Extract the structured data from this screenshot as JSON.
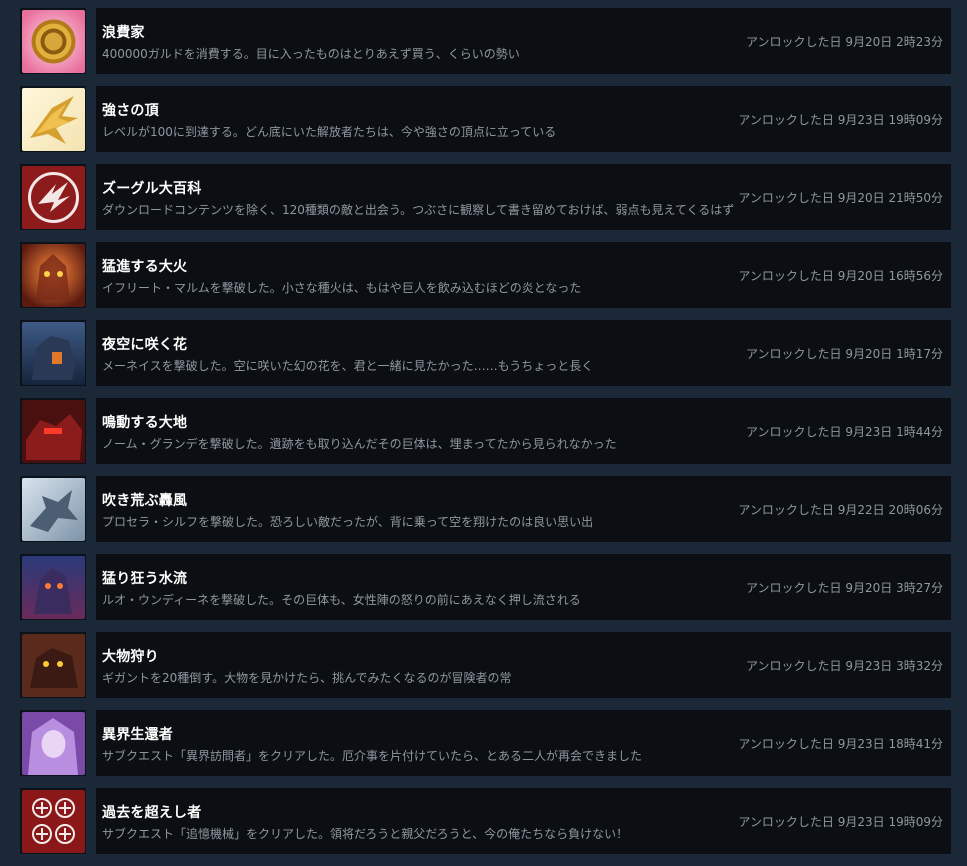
{
  "achievements": [
    {
      "title": "浪費家",
      "desc": "400000ガルドを消費する。目に入ったものはとりあえず買う、くらいの勢い",
      "date": "アンロックした日 9月20日 2時23分",
      "icon": "gold-coin-icon"
    },
    {
      "title": "強さの頂",
      "desc": "レベルが100に到達する。どん底にいた解放者たちは、今や強さの頂点に立っている",
      "date": "アンロックした日 9月23日 19時09分",
      "icon": "golden-bird-icon"
    },
    {
      "title": "ズーグル大百科",
      "desc": "ダウンロードコンテンツを除く、120種類の敵と出会う。つぶさに観察して書き留めておけば、弱点も見えてくるはず",
      "date": "アンロックした日 9月20日 21時50分",
      "icon": "red-claw-emblem-icon"
    },
    {
      "title": "猛進する大火",
      "desc": "イフリート・マルムを撃破した。小さな種火は、もはや巨人を飲み込むほどの炎となった",
      "date": "アンロックした日 9月20日 16時56分",
      "icon": "fire-giant-icon"
    },
    {
      "title": "夜空に咲く花",
      "desc": "メーネイスを撃破した。空に咲いた幻の花を、君と一緒に見たかった……もうちょっと長く",
      "date": "アンロックした日 9月20日 1時17分",
      "icon": "night-giant-icon"
    },
    {
      "title": "鳴動する大地",
      "desc": "ノーム・グランデを撃破した。遺跡をも取り込んだその巨体は、埋まってたから見られなかった",
      "date": "アンロックした日 9月23日 1時44分",
      "icon": "earth-giant-icon"
    },
    {
      "title": "吹き荒ぶ轟風",
      "desc": "プロセラ・シルフを撃破した。恐ろしい敵だったが、背に乗って空を翔けたのは良い思い出",
      "date": "アンロックした日 9月22日 20時06分",
      "icon": "wind-dragon-icon"
    },
    {
      "title": "猛り狂う水流",
      "desc": "ルオ・ウンディーネを撃破した。その巨体も、女性陣の怒りの前にあえなく押し流される",
      "date": "アンロックした日 9月20日 3時27分",
      "icon": "water-giant-icon"
    },
    {
      "title": "大物狩り",
      "desc": "ギガントを20種倒す。大物を見かけたら、挑んでみたくなるのが冒険者の常",
      "date": "アンロックした日 9月23日 3時32分",
      "icon": "giant-beast-icon"
    },
    {
      "title": "異界生還者",
      "desc": "サブクエスト「異界訪問者」をクリアした。厄介事を片付けていたら、とある二人が再会できました",
      "date": "アンロックした日 9月23日 18時41分",
      "icon": "purple-hair-character-icon"
    },
    {
      "title": "過去を超えし者",
      "desc": "サブクエスト「追憶機械」をクリアした。領将だろうと親父だろうと、今の俺たちなら負けない！",
      "date": "アンロックした日 9月23日 19時09分",
      "icon": "snowflake-emblems-icon"
    }
  ]
}
